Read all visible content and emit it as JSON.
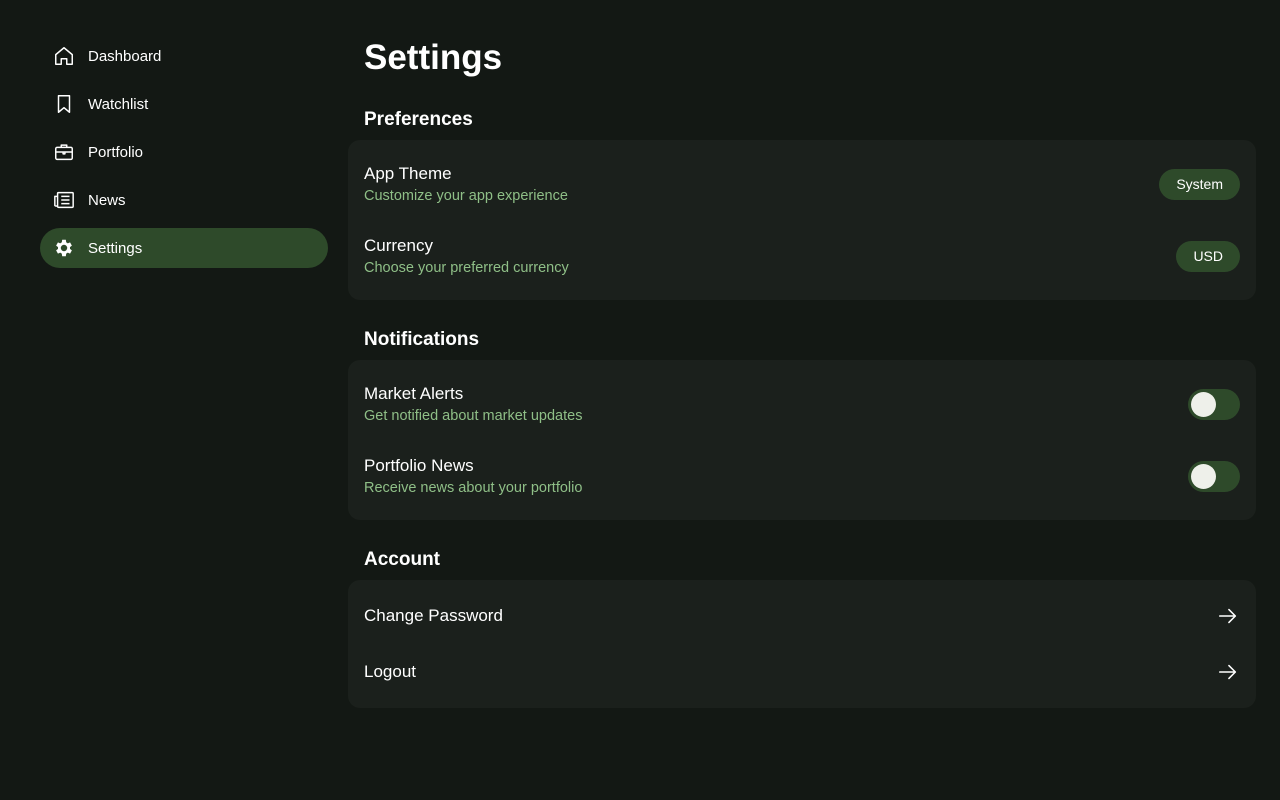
{
  "sidebar": {
    "items": [
      {
        "label": "Dashboard",
        "icon": "home-icon"
      },
      {
        "label": "Watchlist",
        "icon": "bookmark-icon"
      },
      {
        "label": "Portfolio",
        "icon": "briefcase-icon"
      },
      {
        "label": "News",
        "icon": "newspaper-icon"
      },
      {
        "label": "Settings",
        "icon": "gear-icon",
        "active": true
      }
    ]
  },
  "page": {
    "title": "Settings"
  },
  "preferences": {
    "title": "Preferences",
    "theme": {
      "label": "App Theme",
      "desc": "Customize your app experience",
      "value": "System"
    },
    "currency": {
      "label": "Currency",
      "desc": "Choose your preferred currency",
      "value": "USD"
    }
  },
  "notifications": {
    "title": "Notifications",
    "market": {
      "label": "Market Alerts",
      "desc": "Get notified about market updates",
      "enabled": false
    },
    "portfolio": {
      "label": "Portfolio News",
      "desc": "Receive news about your portfolio",
      "enabled": false
    }
  },
  "account": {
    "title": "Account",
    "change_password": {
      "label": "Change Password"
    },
    "logout": {
      "label": "Logout"
    }
  },
  "colors": {
    "background": "#131814",
    "card": "#1b201c",
    "accent": "#2e4a2a",
    "secondary_text": "#8fbf87"
  }
}
